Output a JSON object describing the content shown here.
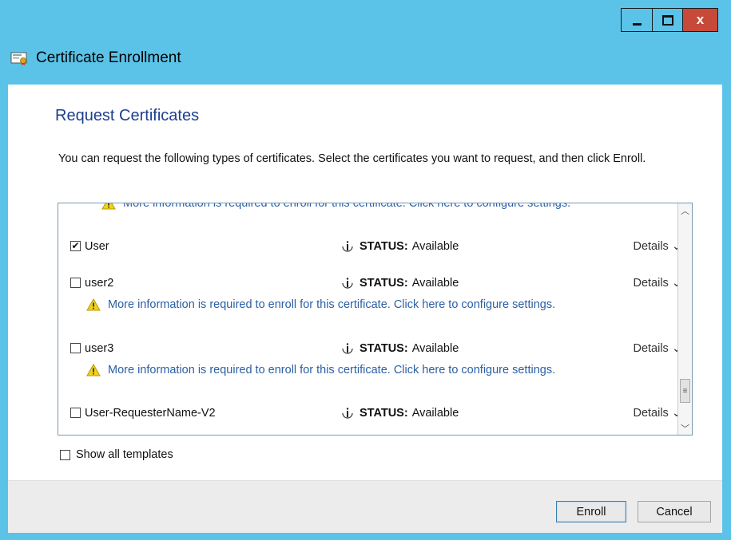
{
  "window": {
    "title": "Certificate Enrollment",
    "minimize_icon": "minimize-icon",
    "maximize_icon": "maximize-icon",
    "close_label": "x"
  },
  "dialog": {
    "heading": "Request Certificates",
    "intro": "You can request the following types of certificates. Select the certificates you want to request, and then click Enroll."
  },
  "list": {
    "partial_warning": "More information is required to enroll for this certificate. Click here to configure settings.",
    "rows": [
      {
        "name": "User",
        "checked": true,
        "status_label": "STATUS:",
        "status_value": "Available",
        "details": "Details",
        "warning": ""
      },
      {
        "name": "user2",
        "checked": false,
        "status_label": "STATUS:",
        "status_value": "Available",
        "details": "Details",
        "warning": "More information is required to enroll for this certificate. Click here to configure settings."
      },
      {
        "name": "user3",
        "checked": false,
        "status_label": "STATUS:",
        "status_value": "Available",
        "details": "Details",
        "warning": "More information is required to enroll for this certificate. Click here to configure settings."
      },
      {
        "name": "User-RequesterName-V2",
        "checked": false,
        "status_label": "STATUS:",
        "status_value": "Available",
        "details": "Details",
        "warning": ""
      }
    ]
  },
  "show_all": {
    "label": "Show all templates",
    "checked": false
  },
  "buttons": {
    "enroll": "Enroll",
    "cancel": "Cancel"
  },
  "colors": {
    "titlebar": "#5bc3e8",
    "heading": "#1e3f8e",
    "link": "#2b5fa6",
    "close": "#c7493a"
  }
}
